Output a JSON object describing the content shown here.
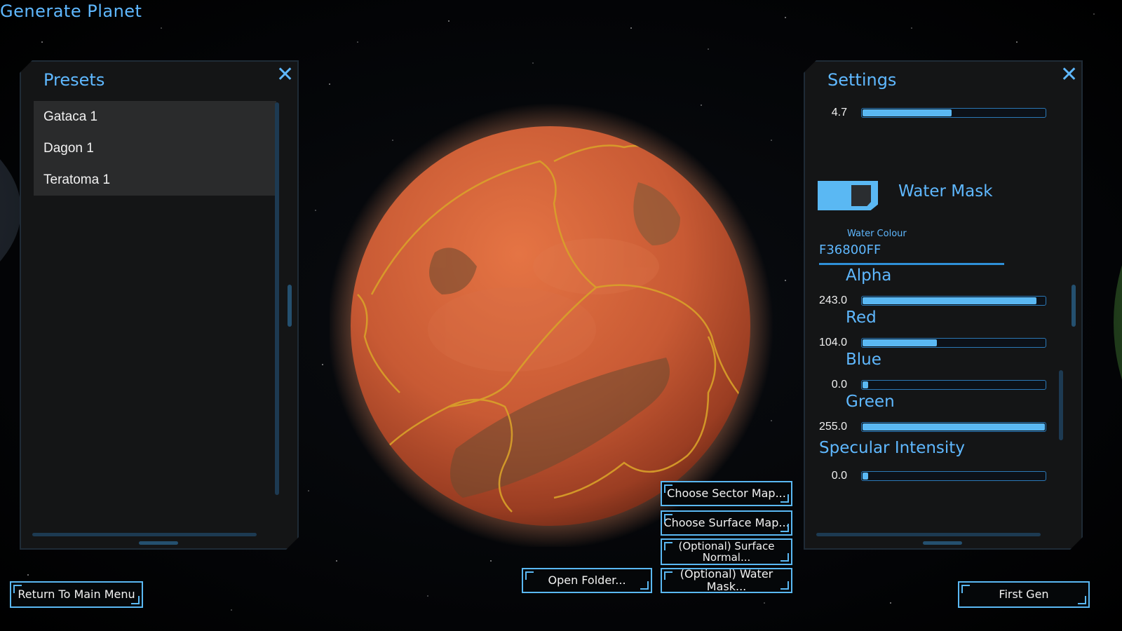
{
  "window_title": "Generate Planet",
  "presets_panel": {
    "title": "Presets",
    "items": [
      "Gataca 1",
      "Dagon 1",
      "Teratoma 1"
    ]
  },
  "settings_panel": {
    "title": "Settings",
    "top_slider": {
      "value": "4.7",
      "fraction": 0.49
    },
    "water_mask_toggle": {
      "label": "Water Mask",
      "on": true
    },
    "water_colour": {
      "label": "Water Colour",
      "value": "F36800FF"
    },
    "sliders": [
      {
        "label": "Alpha",
        "value": "243.0",
        "fraction": 0.953
      },
      {
        "label": "Red",
        "value": "104.0",
        "fraction": 0.408
      },
      {
        "label": "Blue",
        "value": "0.0",
        "fraction": 0.0
      },
      {
        "label": "Green",
        "value": "255.0",
        "fraction": 1.0
      }
    ],
    "specular": {
      "label": "Specular Intensity",
      "value": "0.0",
      "fraction": 0.0
    }
  },
  "buttons": {
    "choose_sector_map": "Choose Sector Map...",
    "choose_surface_map": "Choose Surface Map...",
    "surface_normal": "(Optional) Surface Normal...",
    "water_mask": "(Optional) Water Mask...",
    "open_folder": "Open Folder...",
    "return_main_menu": "Return To Main Menu",
    "first_gen": "First Gen"
  },
  "colors": {
    "accent": "#5fb8ff",
    "slider_fill": "#5ab8f3",
    "planet_base": "#c85a34"
  }
}
